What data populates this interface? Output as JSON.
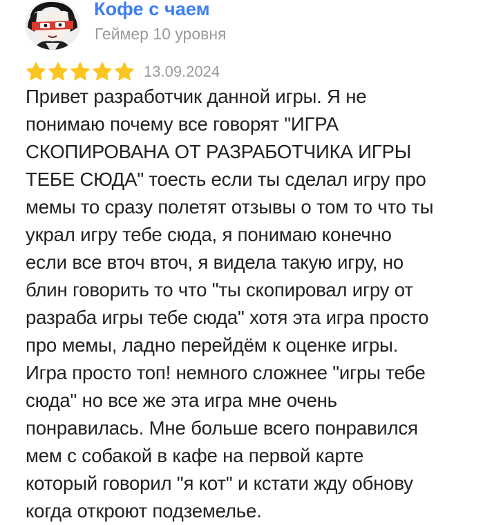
{
  "review": {
    "author": {
      "name": "Кофе с чаем",
      "level": "Геймер 10 уровня",
      "avatar_icon": "anime-character-avatar"
    },
    "rating": {
      "stars": 5,
      "max": 5,
      "star_color": "#fcc521",
      "date": "13.09.2024"
    },
    "text": "Привет разработчик данной игры. Я не\nпонимаю почему все говорят \"ИГРА\nСКОПИРОВАНА ОТ РАЗРАБОТЧИКА ИГРЫ\nТЕБЕ СЮДА\" тоесть если ты сделал игру про\nмемы то сразу полетят отзывы о том то что ты\nукрал игру тебе сюда, я понимаю конечно\nесли все вточ вточ, я видела такую игру, но\nблин говорить то что \"ты скопировал игру от\nразраба игры тебе сюда\" хотя эта игра просто\nпро мемы, ладно перейдём к оценке игры.\nИгра просто топ! немного сложнее \"игры тебе\nсюда\" но все же эта игра мне очень\nпонравилась. Мне больше всего понравился\nмем с собакой в кафе на первой карте\nкоторый говорил \"я кот\" и кстати жду обнову\nкогда откроют подземелье."
  }
}
